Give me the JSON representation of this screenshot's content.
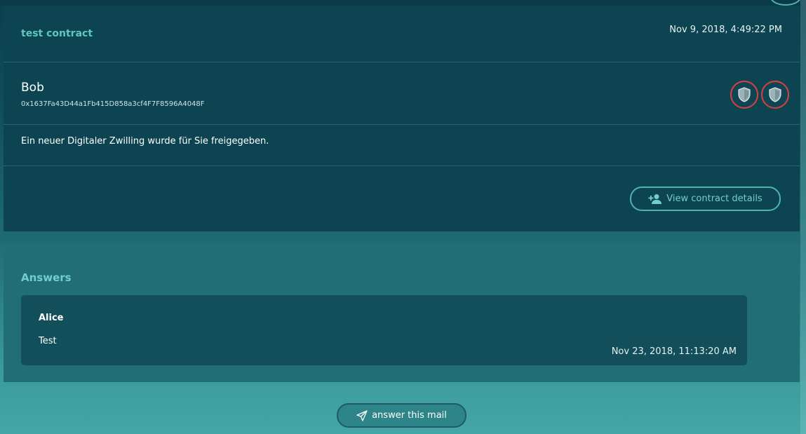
{
  "mail": {
    "title": "test contract",
    "date": "Nov 9, 2018, 4:49:22 PM",
    "sender_name": "Bob",
    "sender_address": "0x1637Fa43D44a1Fb415D858a3cf4F7F8596A4048F",
    "body": "Ein neuer Digitaler Zwilling wurde für Sie freigegeben.",
    "view_details_label": "View contract details",
    "icons": [
      "shield-icon",
      "shield-icon",
      "add-person-icon"
    ]
  },
  "answers": {
    "heading": "Answers",
    "items": [
      {
        "author": "Alice",
        "text": "Test",
        "date": "Nov 23, 2018, 11:13:20 AM"
      }
    ]
  },
  "actions": {
    "answer_label": "answer this mail",
    "icon": "send-icon"
  },
  "colors": {
    "accent": "#4fb3b0",
    "accent_text": "#6fd0cb",
    "shield_border": "#d9403f",
    "card_bg": "#0d4452",
    "answers_bg": "#216e76"
  }
}
